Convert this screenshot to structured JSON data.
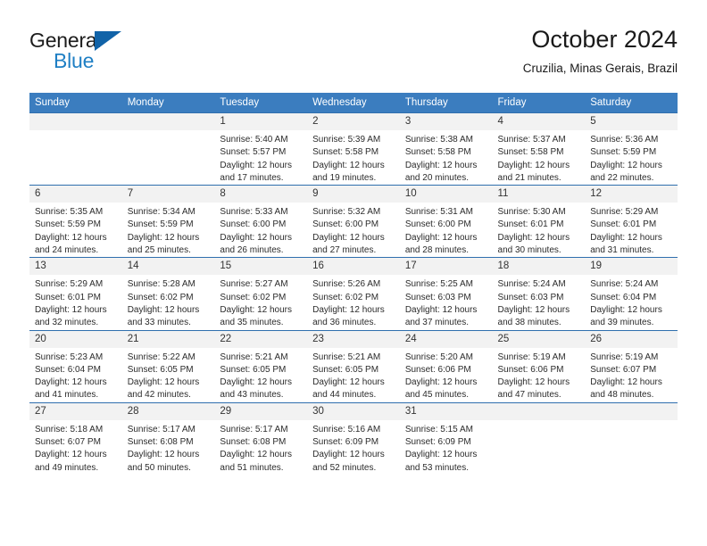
{
  "brand": {
    "line1": "General",
    "line2": "Blue",
    "triangle_color": "#1163a8",
    "blue_text_color": "#1f7fc4"
  },
  "header": {
    "title": "October 2024",
    "subtitle": "Cruzilia, Minas Gerais, Brazil"
  },
  "theme": {
    "header_bg": "#3b7dbf",
    "header_text": "#ffffff",
    "row_rule": "#2f6fae",
    "daynum_bg": "#f2f2f2"
  },
  "weekday_headers": [
    "Sunday",
    "Monday",
    "Tuesday",
    "Wednesday",
    "Thursday",
    "Friday",
    "Saturday"
  ],
  "weeks": [
    [
      {
        "day": "",
        "lines": []
      },
      {
        "day": "",
        "lines": []
      },
      {
        "day": "1",
        "lines": [
          "Sunrise: 5:40 AM",
          "Sunset: 5:57 PM",
          "Daylight: 12 hours",
          "and 17 minutes."
        ]
      },
      {
        "day": "2",
        "lines": [
          "Sunrise: 5:39 AM",
          "Sunset: 5:58 PM",
          "Daylight: 12 hours",
          "and 19 minutes."
        ]
      },
      {
        "day": "3",
        "lines": [
          "Sunrise: 5:38 AM",
          "Sunset: 5:58 PM",
          "Daylight: 12 hours",
          "and 20 minutes."
        ]
      },
      {
        "day": "4",
        "lines": [
          "Sunrise: 5:37 AM",
          "Sunset: 5:58 PM",
          "Daylight: 12 hours",
          "and 21 minutes."
        ]
      },
      {
        "day": "5",
        "lines": [
          "Sunrise: 5:36 AM",
          "Sunset: 5:59 PM",
          "Daylight: 12 hours",
          "and 22 minutes."
        ]
      }
    ],
    [
      {
        "day": "6",
        "lines": [
          "Sunrise: 5:35 AM",
          "Sunset: 5:59 PM",
          "Daylight: 12 hours",
          "and 24 minutes."
        ]
      },
      {
        "day": "7",
        "lines": [
          "Sunrise: 5:34 AM",
          "Sunset: 5:59 PM",
          "Daylight: 12 hours",
          "and 25 minutes."
        ]
      },
      {
        "day": "8",
        "lines": [
          "Sunrise: 5:33 AM",
          "Sunset: 6:00 PM",
          "Daylight: 12 hours",
          "and 26 minutes."
        ]
      },
      {
        "day": "9",
        "lines": [
          "Sunrise: 5:32 AM",
          "Sunset: 6:00 PM",
          "Daylight: 12 hours",
          "and 27 minutes."
        ]
      },
      {
        "day": "10",
        "lines": [
          "Sunrise: 5:31 AM",
          "Sunset: 6:00 PM",
          "Daylight: 12 hours",
          "and 28 minutes."
        ]
      },
      {
        "day": "11",
        "lines": [
          "Sunrise: 5:30 AM",
          "Sunset: 6:01 PM",
          "Daylight: 12 hours",
          "and 30 minutes."
        ]
      },
      {
        "day": "12",
        "lines": [
          "Sunrise: 5:29 AM",
          "Sunset: 6:01 PM",
          "Daylight: 12 hours",
          "and 31 minutes."
        ]
      }
    ],
    [
      {
        "day": "13",
        "lines": [
          "Sunrise: 5:29 AM",
          "Sunset: 6:01 PM",
          "Daylight: 12 hours",
          "and 32 minutes."
        ]
      },
      {
        "day": "14",
        "lines": [
          "Sunrise: 5:28 AM",
          "Sunset: 6:02 PM",
          "Daylight: 12 hours",
          "and 33 minutes."
        ]
      },
      {
        "day": "15",
        "lines": [
          "Sunrise: 5:27 AM",
          "Sunset: 6:02 PM",
          "Daylight: 12 hours",
          "and 35 minutes."
        ]
      },
      {
        "day": "16",
        "lines": [
          "Sunrise: 5:26 AM",
          "Sunset: 6:02 PM",
          "Daylight: 12 hours",
          "and 36 minutes."
        ]
      },
      {
        "day": "17",
        "lines": [
          "Sunrise: 5:25 AM",
          "Sunset: 6:03 PM",
          "Daylight: 12 hours",
          "and 37 minutes."
        ]
      },
      {
        "day": "18",
        "lines": [
          "Sunrise: 5:24 AM",
          "Sunset: 6:03 PM",
          "Daylight: 12 hours",
          "and 38 minutes."
        ]
      },
      {
        "day": "19",
        "lines": [
          "Sunrise: 5:24 AM",
          "Sunset: 6:04 PM",
          "Daylight: 12 hours",
          "and 39 minutes."
        ]
      }
    ],
    [
      {
        "day": "20",
        "lines": [
          "Sunrise: 5:23 AM",
          "Sunset: 6:04 PM",
          "Daylight: 12 hours",
          "and 41 minutes."
        ]
      },
      {
        "day": "21",
        "lines": [
          "Sunrise: 5:22 AM",
          "Sunset: 6:05 PM",
          "Daylight: 12 hours",
          "and 42 minutes."
        ]
      },
      {
        "day": "22",
        "lines": [
          "Sunrise: 5:21 AM",
          "Sunset: 6:05 PM",
          "Daylight: 12 hours",
          "and 43 minutes."
        ]
      },
      {
        "day": "23",
        "lines": [
          "Sunrise: 5:21 AM",
          "Sunset: 6:05 PM",
          "Daylight: 12 hours",
          "and 44 minutes."
        ]
      },
      {
        "day": "24",
        "lines": [
          "Sunrise: 5:20 AM",
          "Sunset: 6:06 PM",
          "Daylight: 12 hours",
          "and 45 minutes."
        ]
      },
      {
        "day": "25",
        "lines": [
          "Sunrise: 5:19 AM",
          "Sunset: 6:06 PM",
          "Daylight: 12 hours",
          "and 47 minutes."
        ]
      },
      {
        "day": "26",
        "lines": [
          "Sunrise: 5:19 AM",
          "Sunset: 6:07 PM",
          "Daylight: 12 hours",
          "and 48 minutes."
        ]
      }
    ],
    [
      {
        "day": "27",
        "lines": [
          "Sunrise: 5:18 AM",
          "Sunset: 6:07 PM",
          "Daylight: 12 hours",
          "and 49 minutes."
        ]
      },
      {
        "day": "28",
        "lines": [
          "Sunrise: 5:17 AM",
          "Sunset: 6:08 PM",
          "Daylight: 12 hours",
          "and 50 minutes."
        ]
      },
      {
        "day": "29",
        "lines": [
          "Sunrise: 5:17 AM",
          "Sunset: 6:08 PM",
          "Daylight: 12 hours",
          "and 51 minutes."
        ]
      },
      {
        "day": "30",
        "lines": [
          "Sunrise: 5:16 AM",
          "Sunset: 6:09 PM",
          "Daylight: 12 hours",
          "and 52 minutes."
        ]
      },
      {
        "day": "31",
        "lines": [
          "Sunrise: 5:15 AM",
          "Sunset: 6:09 PM",
          "Daylight: 12 hours",
          "and 53 minutes."
        ]
      },
      {
        "day": "",
        "lines": []
      },
      {
        "day": "",
        "lines": []
      }
    ]
  ]
}
